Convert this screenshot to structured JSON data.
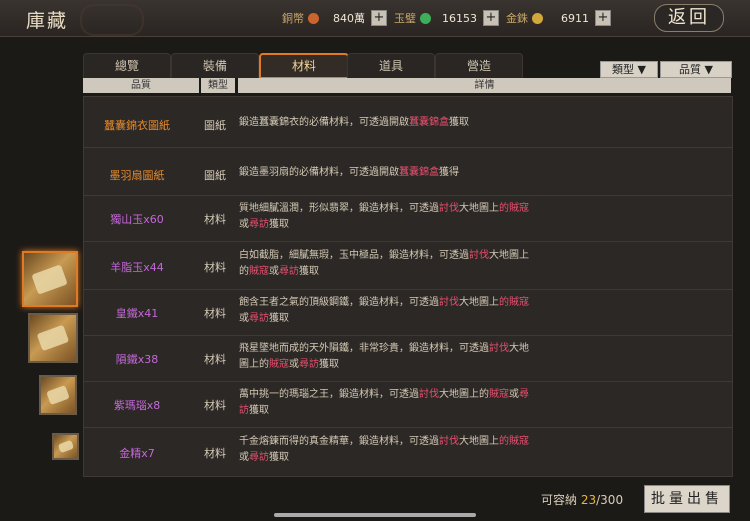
{
  "header": {
    "title": "庫藏",
    "back_label": "返回"
  },
  "currencies": [
    {
      "label": "銅幣",
      "value": "840萬",
      "color": "#c9652e"
    },
    {
      "label": "玉璧",
      "value": "16153",
      "color": "#3fae5a"
    },
    {
      "label": "金銖",
      "value": "6911",
      "color": "#d2a83a"
    }
  ],
  "tabs": [
    {
      "label": "總覽"
    },
    {
      "label": "裝備"
    },
    {
      "label": "材料",
      "active": true
    },
    {
      "label": "道具"
    },
    {
      "label": "營造"
    }
  ],
  "filters": {
    "type_label": "類型 ▼",
    "quality_label": "品質 ▼"
  },
  "columns": {
    "quality": "品質",
    "type": "類型",
    "detail": "詳情"
  },
  "rows": [
    {
      "name": "蠶囊錦衣圖紙",
      "name_color": "#e6892a",
      "type": "圖紙",
      "desc_a": "鍛造蠶囊錦衣的必備材料，可透過開啟",
      "desc_hl": "蠶囊錦盒",
      "desc_b": "獲取"
    },
    {
      "name": "墨羽扇圖紙",
      "name_color": "#e6892a",
      "type": "圖紙",
      "desc_a": "鍛造墨羽扇的必備材料，可透過開啟",
      "desc_hl": "蠶囊錦盒",
      "desc_b": "獲得"
    },
    {
      "name": "獨山玉x60",
      "name_color": "#c568d8",
      "type": "材料",
      "desc_a": "質地細膩溫潤，形似翡翠，鍛造材料，可透過",
      "desc_hl": "討伐",
      "desc_b": "大地圖上",
      "desc_hl2": "的賊寇",
      "desc_c": "或",
      "desc_hl3": "尋訪",
      "desc_d": "獲取"
    },
    {
      "name": "羊脂玉x44",
      "name_color": "#c568d8",
      "type": "材料",
      "desc_a": "白如截脂，細膩無瑕，玉中極品，鍛造材料，可透過",
      "desc_hl": "討伐",
      "desc_b": "大",
      "desc_c": "地圖上的",
      "desc_hl2": "賊寇",
      "desc_c2": "或",
      "desc_hl3": "尋訪",
      "desc_d": "獲取"
    },
    {
      "name": "皇鐵x41",
      "name_color": "#c568d8",
      "type": "材料",
      "desc_a": "飽含王者之氣的頂級鋼鐵，鍛造材料，可透過",
      "desc_hl": "討伐",
      "desc_b": "大地圖上",
      "desc_hl2": "的賊寇",
      "desc_c": "或",
      "desc_hl3": "尋訪",
      "desc_d": "獲取"
    },
    {
      "name": "隕鐵x38",
      "name_color": "#c568d8",
      "type": "材料",
      "desc_a": "飛星墜地而成的天外隕鐵，非常珍貴，鍛造材料，可透過",
      "desc_hl": "討",
      "desc_b": "",
      "desc_hl2": "伐",
      "desc_c": "大地圖上的",
      "desc_hl3": "賊寇",
      "desc_c2": "或",
      "desc_hl4": "尋訪",
      "desc_d": "獲取"
    },
    {
      "name": "紫瑪瑙x8",
      "name_color": "#c568d8",
      "type": "材料",
      "desc_a": "萬中挑一的瑪瑙之王，鍛造材料，可透過",
      "desc_hl": "討伐",
      "desc_b": "大地圖上的",
      "desc_hl2": "賊",
      "desc_c": "",
      "desc_hl3": "寇",
      "desc_c2": "或",
      "desc_hl4": "尋訪",
      "desc_d": "獲取"
    },
    {
      "name": "金精x7",
      "name_color": "#c568d8",
      "type": "材料",
      "desc_a": "千金熔鍊而得的真金精華，鍛造材料，可透過",
      "desc_hl": "討伐",
      "desc_b": "大地圖上",
      "desc_hl2": "的賊寇",
      "desc_c": "或",
      "desc_hl3": "尋訪",
      "desc_d": "獲取"
    }
  ],
  "footer": {
    "capacity_label": "可容納",
    "used": "23",
    "total": "/300",
    "sell_label": "批量出售"
  }
}
